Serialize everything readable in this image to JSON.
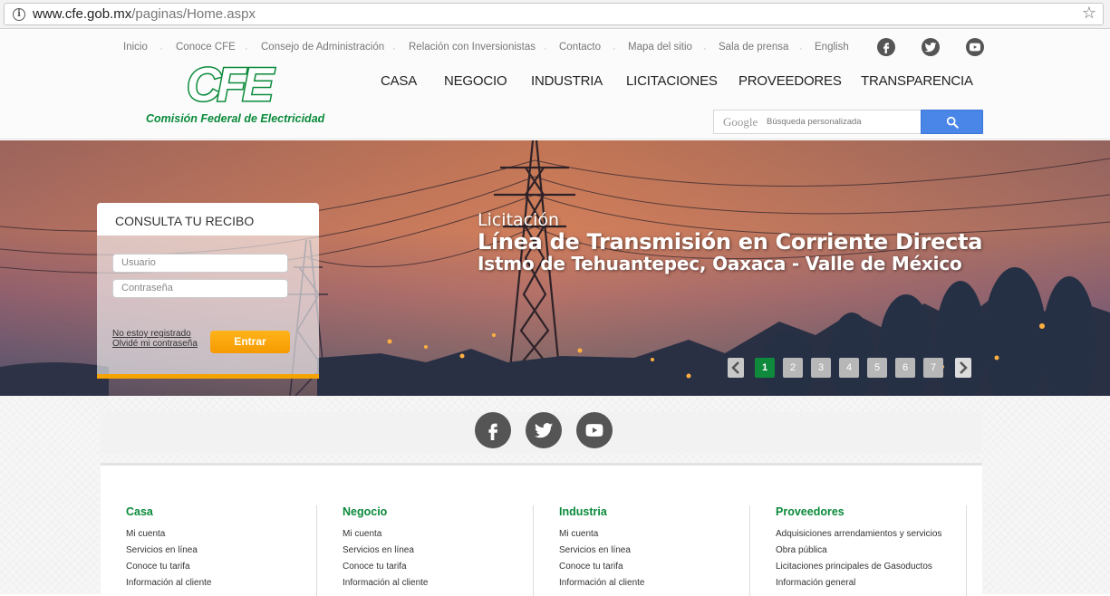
{
  "browser": {
    "url_host": "www.cfe.gob.mx",
    "url_path": "/paginas/Home.aspx"
  },
  "top_nav": [
    "Inicio",
    "Conoce CFE",
    "Consejo de Administración",
    "Relación con Inversionistas",
    "Contacto",
    "Mapa del sitio",
    "Sala de prensa",
    "English"
  ],
  "logo": {
    "mark": "CFE",
    "subtitle": "Comisión Federal de Electricidad"
  },
  "main_nav": [
    "CASA",
    "NEGOCIO",
    "INDUSTRIA",
    "LICITACIONES",
    "PROVEEDORES",
    "TRANSPARENCIA"
  ],
  "search": {
    "brand": "Google",
    "placeholder": "Búsqueda personalizada"
  },
  "hero": {
    "line1": "Licitación",
    "line2": "Línea de Transmisión en Corriente Directa",
    "line3": "Istmo de Tehuantepec, Oaxaca - Valle de México"
  },
  "login": {
    "title": "CONSULTA TU RECIBO",
    "user_placeholder": "Usuario",
    "password_placeholder": "Contraseña",
    "not_registered": "No estoy registrado",
    "forgot": "Olvidé mi contraseña",
    "submit": "Entrar"
  },
  "pager": {
    "pages": [
      "1",
      "2",
      "3",
      "4",
      "5",
      "6",
      "7"
    ],
    "active": "1"
  },
  "colors": {
    "brand_green": "#0a8a3a",
    "accent_orange": "#f5a300",
    "search_blue": "#4a86e8"
  },
  "footer": {
    "columns": [
      {
        "title": "Casa",
        "links": [
          "Mi cuenta",
          "Servicios en línea",
          "Conoce tu tarifa",
          "Información al cliente"
        ]
      },
      {
        "title": "Negocio",
        "links": [
          "Mi cuenta",
          "Servicios en línea",
          "Conoce tu tarifa",
          "Información al cliente"
        ]
      },
      {
        "title": "Industria",
        "links": [
          "Mi cuenta",
          "Servicios en línea",
          "Conoce tu tarifa",
          "Información al cliente"
        ]
      },
      {
        "title": "Proveedores",
        "links": [
          "Adquisiciones arrendamientos y servicios",
          "Obra pública",
          "Licitaciones principales de Gasoductos",
          "Información general"
        ]
      }
    ]
  }
}
